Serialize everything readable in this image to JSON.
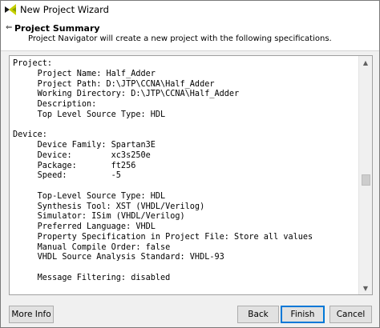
{
  "window": {
    "title": "New Project Wizard"
  },
  "header": {
    "title": "Project Summary",
    "description": "Project Navigator will create a new project with the following specifications."
  },
  "summary_text": "Project:\n     Project Name: Half_Adder\n     Project Path: D:\\JTP\\CCNA\\Half_Adder\n     Working Directory: D:\\JTP\\CCNA\\Half_Adder\n     Description:\n     Top Level Source Type: HDL\n\nDevice:\n     Device Family: Spartan3E\n     Device:        xc3s250e\n     Package:       ft256\n     Speed:         -5\n\n     Top-Level Source Type: HDL\n     Synthesis Tool: XST (VHDL/Verilog)\n     Simulator: ISim (VHDL/Verilog)\n     Preferred Language: VHDL\n     Property Specification in Project File: Store all values\n     Manual Compile Order: false\n     VHDL Source Analysis Standard: VHDL-93\n\n     Message Filtering: disabled",
  "buttons": {
    "more_info": "More Info",
    "back": "Back",
    "finish": "Finish",
    "cancel": "Cancel"
  },
  "icons": {
    "app": "xilinx-logo-icon",
    "back": "back-arrow-icon"
  }
}
